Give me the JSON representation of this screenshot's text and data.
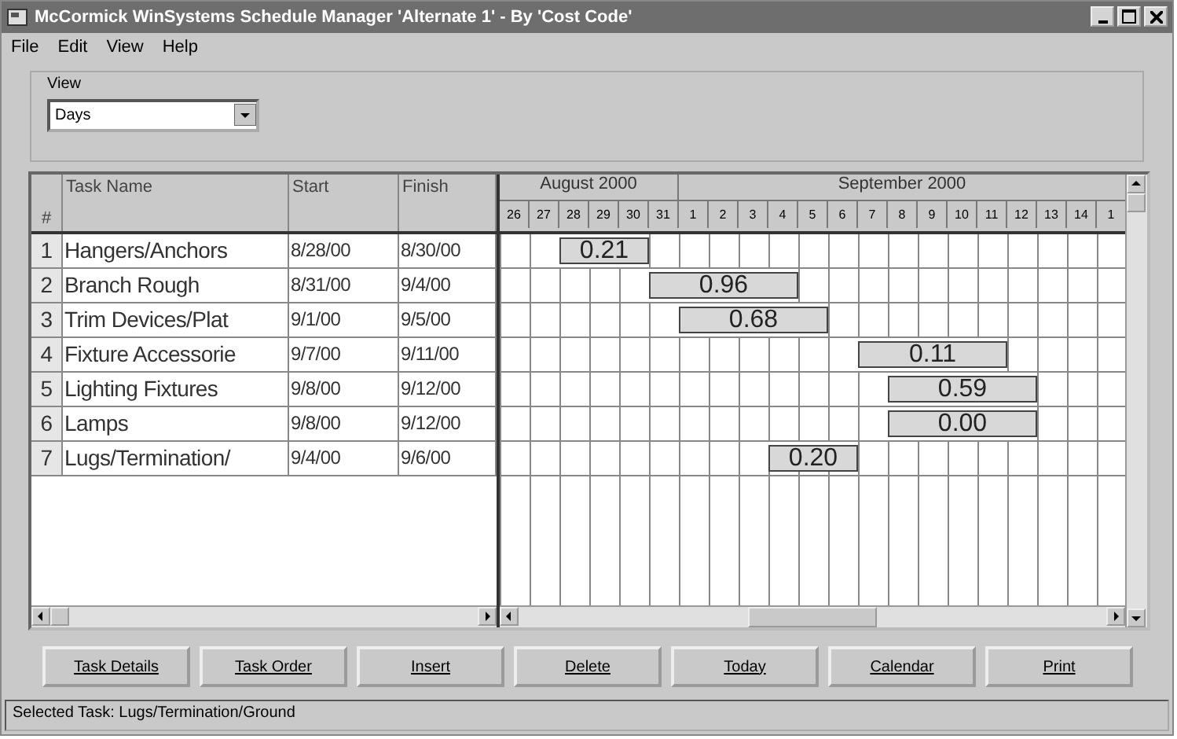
{
  "window": {
    "title": "McCormick WinSystems Schedule Manager  'Alternate 1' - By 'Cost Code'"
  },
  "menu": [
    "File",
    "Edit",
    "View",
    "Help"
  ],
  "view": {
    "label": "View",
    "value": "Days"
  },
  "table": {
    "columns": [
      "#",
      "Task Name",
      "Start",
      "Finish"
    ],
    "rows": [
      {
        "cells": [
          "1",
          "Hangers/Anchors",
          "8/28/00",
          "8/30/00"
        ],
        "bar": {
          "label": "0.21",
          "cells": [
            false,
            false,
            true,
            true,
            true,
            false,
            false,
            false,
            false,
            false,
            false,
            false,
            false,
            false,
            false,
            false,
            false,
            false,
            false,
            false,
            false
          ]
        }
      },
      {
        "cells": [
          "2",
          "Branch Rough",
          "8/31/00",
          "9/4/00"
        ],
        "bar": {
          "label": "0.96",
          "cells": [
            false,
            false,
            false,
            false,
            false,
            true,
            true,
            true,
            true,
            true,
            false,
            false,
            false,
            false,
            false,
            false,
            false,
            false,
            false,
            false,
            false
          ]
        }
      },
      {
        "cells": [
          "3",
          "Trim Devices/Plat",
          "9/1/00",
          "9/5/00"
        ],
        "bar": {
          "label": "0.68",
          "cells": [
            false,
            false,
            false,
            false,
            false,
            false,
            true,
            true,
            true,
            true,
            true,
            false,
            false,
            false,
            false,
            false,
            false,
            false,
            false,
            false,
            false
          ]
        }
      },
      {
        "cells": [
          "4",
          "Fixture Accessorie",
          "9/7/00",
          "9/11/00"
        ],
        "bar": {
          "label": "0.11",
          "cells": [
            false,
            false,
            false,
            false,
            false,
            false,
            false,
            false,
            false,
            false,
            false,
            false,
            true,
            true,
            true,
            true,
            true,
            false,
            false,
            false,
            false
          ]
        }
      },
      {
        "cells": [
          "5",
          "Lighting Fixtures",
          "9/8/00",
          "9/12/00"
        ],
        "bar": {
          "label": "0.59",
          "cells": [
            false,
            false,
            false,
            false,
            false,
            false,
            false,
            false,
            false,
            false,
            false,
            false,
            false,
            true,
            true,
            true,
            true,
            true,
            false,
            false,
            false
          ]
        }
      },
      {
        "cells": [
          "6",
          "Lamps",
          "9/8/00",
          "9/12/00"
        ],
        "bar": {
          "label": "0.00",
          "cells": [
            false,
            false,
            false,
            false,
            false,
            false,
            false,
            false,
            false,
            false,
            false,
            false,
            false,
            true,
            true,
            true,
            true,
            true,
            false,
            false,
            false
          ]
        }
      },
      {
        "cells": [
          "7",
          "Lugs/Termination/",
          "9/4/00",
          "9/6/00"
        ],
        "bar": {
          "label": "0.20",
          "cells": [
            false,
            false,
            false,
            false,
            false,
            false,
            false,
            false,
            false,
            true,
            true,
            true,
            false,
            false,
            false,
            false,
            false,
            false,
            false,
            false,
            false
          ]
        }
      }
    ]
  },
  "gantt": {
    "months": [
      {
        "label": "August 2000",
        "days": [
          "26",
          "27",
          "28",
          "29",
          "30",
          "31"
        ]
      },
      {
        "label": "September 2000",
        "days": [
          "1",
          "2",
          "3",
          "4",
          "5",
          "6",
          "7",
          "8",
          "9",
          "10",
          "11",
          "12",
          "13",
          "14",
          "1"
        ]
      }
    ]
  },
  "buttons": [
    "Task Details",
    "Task Order",
    "Insert",
    "Delete",
    "Today",
    "Calendar",
    "Print"
  ],
  "status_bar": "Selected Task: Lugs/Termination/Ground"
}
